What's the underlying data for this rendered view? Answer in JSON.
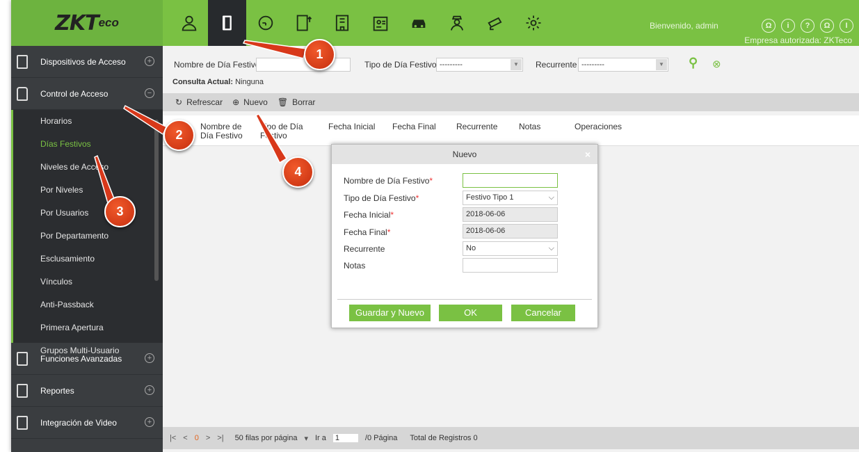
{
  "header": {
    "logo": "ZKTeco",
    "welcome": "Bienvenido, admin",
    "company": "Empresa autorizada: ZKTeco",
    "top_icons": [
      "person-icon",
      "door-icon",
      "clock-icon",
      "elevator-icon",
      "building-icon",
      "badge-icon",
      "car-icon",
      "guard-icon",
      "camera-icon",
      "gear-icon"
    ],
    "right_icons": [
      "user-circle-icon",
      "info-icon",
      "help-icon",
      "account-icon",
      "power-icon"
    ]
  },
  "sidebar": {
    "sections": [
      {
        "label": "Dispositivos de Acceso",
        "toggle": "+"
      },
      {
        "label": "Control de Acceso",
        "toggle": "−"
      }
    ],
    "items": [
      "Horarios",
      "Días Festivos",
      "Niveles de Acceso",
      "Por Niveles",
      "Por Usuarios",
      "Por Departamento",
      "Esclusamiento",
      "Vínculos",
      "Anti-Passback",
      "Primera Apertura",
      "Grupos Multi-Usuario"
    ],
    "bottom_sections": [
      {
        "label": "Funciones Avanzadas",
        "toggle": "+"
      },
      {
        "label": "Reportes",
        "toggle": "+"
      },
      {
        "label": "Integración de Video",
        "toggle": "+"
      }
    ]
  },
  "filter": {
    "name_label": "Nombre de Día Festivo",
    "type_label": "Tipo de Día Festivo",
    "type_value": "---------",
    "recurring_label": "Recurrente",
    "recurring_value": "---------",
    "consulta": "Consulta Actual:",
    "consulta_value": "Ninguna"
  },
  "toolbar": {
    "refresh": "Refrescar",
    "new": "Nuevo",
    "delete": "Borrar"
  },
  "table": {
    "headers": [
      "Nombre de Día Festivo",
      "Tipo de Día Festivo",
      "Fecha Inicial",
      "Fecha Final",
      "Recurrente",
      "Notas",
      "Operaciones"
    ]
  },
  "pager": {
    "first": "|<",
    "prev": "<",
    "current": "0",
    "next": ">",
    "last": ">|",
    "rows": "50 filas por página",
    "goto": "Ir a",
    "goto_value": "1",
    "pages": "/0 Página",
    "total": "Total de Registros 0"
  },
  "dialog": {
    "title": "Nuevo",
    "close": "×",
    "fields": [
      {
        "label": "Nombre de Día Festivo",
        "value": ""
      },
      {
        "label": "Tipo de Día Festivo",
        "value": "Festivo Tipo 1"
      },
      {
        "label": "Fecha Inicial",
        "value": "2018-06-06"
      },
      {
        "label": "Fecha Final",
        "value": "2018-06-06"
      },
      {
        "label": "Recurrente",
        "value": "No"
      },
      {
        "label": "Notas",
        "value": ""
      }
    ],
    "required_mark": "*",
    "buttons": {
      "save_new": "Guardar y Nuevo",
      "ok": "OK",
      "cancel": "Cancelar"
    }
  },
  "callouts": [
    "1",
    "2",
    "3",
    "4"
  ],
  "colors": {
    "brand_green": "#7ac143",
    "sidebar_dark": "#3a3d40",
    "callout": "#e0451f"
  }
}
